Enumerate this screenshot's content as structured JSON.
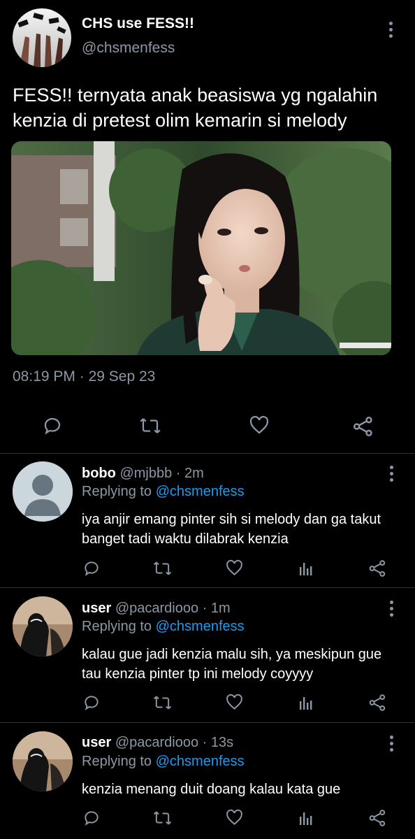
{
  "tweet": {
    "display_name": "CHS use FESS!!",
    "handle": "@chsmenfess",
    "text": "FESS!! ternyata anak beasiswa yg ngalahin kenzia di pretest olim kemarin si melody",
    "time": "08:19 PM",
    "separator": "·",
    "date": "29 Sep 23",
    "actions": [
      "reply-icon",
      "retweet-icon",
      "like-icon",
      "share-icon"
    ]
  },
  "replying_label": "Replying to",
  "replies": [
    {
      "name": "bobo",
      "handle": "@mjbbb",
      "time": "· 2m",
      "replying_to": "@chsmenfess",
      "text": "iya anjir emang pinter sih si melody dan ga takut banget tadi waktu dilabrak kenzia"
    },
    {
      "name": "user",
      "handle": "@pacardiooo",
      "time": "· 1m",
      "replying_to": "@chsmenfess",
      "text": "kalau gue jadi kenzia malu sih, ya meskipun gue tau kenzia pinter tp ini melody coyyyy"
    },
    {
      "name": "user",
      "handle": "@pacardiooo",
      "time": "· 13s",
      "replying_to": "@chsmenfess",
      "text": "kenzia menang duit doang kalau kata gue"
    }
  ],
  "colors": {
    "background": "#000000",
    "text": "#ffffff",
    "muted": "#8b98a5",
    "link": "#1d9bf0",
    "divider": "#2f3336"
  }
}
